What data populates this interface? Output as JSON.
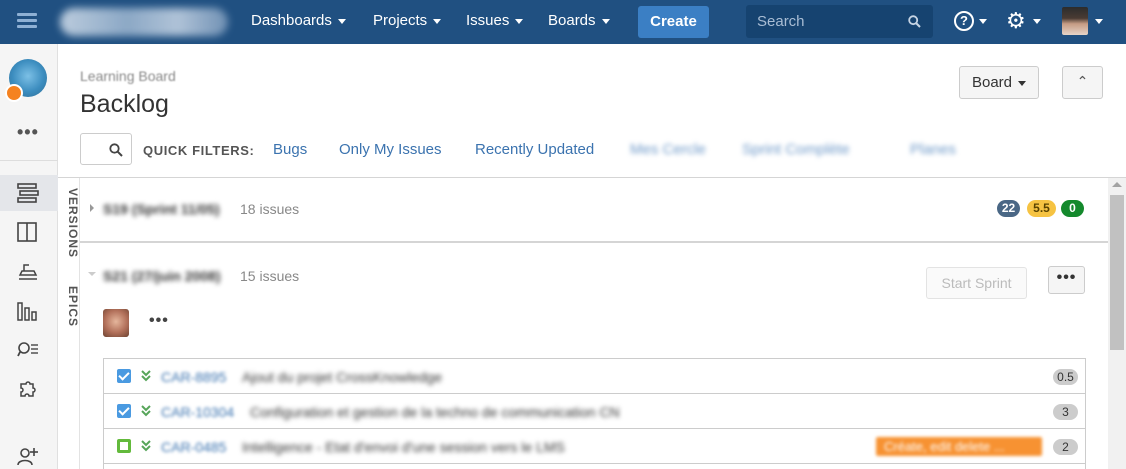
{
  "topnav": {
    "menu": [
      {
        "label": "Dashboards"
      },
      {
        "label": "Projects"
      },
      {
        "label": "Issues"
      },
      {
        "label": "Boards"
      }
    ],
    "create_label": "Create",
    "search_placeholder": "Search",
    "help_glyph": "?",
    "settings_glyph": "⚙",
    "icons": [
      "app-switcher-icon",
      "search-icon",
      "help-icon",
      "gear-icon",
      "user-avatar"
    ]
  },
  "sidebar": {
    "more_glyph": "•••",
    "icons": [
      "backlog-icon",
      "active-sprints-icon",
      "releases-icon",
      "reports-icon",
      "issues-icon",
      "components-icon",
      "add-people-icon"
    ],
    "active": "backlog-icon"
  },
  "header": {
    "breadcrumb": "Learning Board",
    "title": "Backlog",
    "board_button": "Board",
    "collapse_glyph": "⌃"
  },
  "quick_filters": {
    "label": "QUICK FILTERS:",
    "items": [
      "Bugs",
      "Only My Issues",
      "Recently Updated",
      "Mes Cercle",
      "Sprint Complète",
      "Planes"
    ]
  },
  "side_tabs": [
    "VERSIONS",
    "EPICS"
  ],
  "sprints": [
    {
      "name": "S19 (Sprint 11/05)",
      "issue_count": "18 issues",
      "badges": [
        {
          "value": "22",
          "color": "#4a6785"
        },
        {
          "value": "5.5",
          "color": "#f6c342"
        },
        {
          "value": "0",
          "color": "#14892c"
        }
      ]
    },
    {
      "name": "S21 (27/juin 2008)",
      "issue_count": "15 issues",
      "start_sprint_label": "Start Sprint",
      "more_label": "•••",
      "assignee_more": "•••"
    }
  ],
  "issues": [
    {
      "type": "task",
      "key": "CAR-8895",
      "summary": "Ajout du projet CrossKnowledge",
      "estimate": "0.5"
    },
    {
      "type": "task",
      "key": "CAR-10304",
      "summary": "Configuration et gestion de la techno de communication CN",
      "estimate": "3"
    },
    {
      "type": "story",
      "key": "CAR-0485",
      "summary": "Intelligence - Etat d'envoi d'une session vers le LMS",
      "epic": "Créate, edit delete ...",
      "estimate": "2"
    }
  ],
  "colors": {
    "nav_bg": "#205081",
    "create_btn": "#3b7fc4",
    "link": "#3b73af",
    "epic_orange": "#f79232"
  }
}
